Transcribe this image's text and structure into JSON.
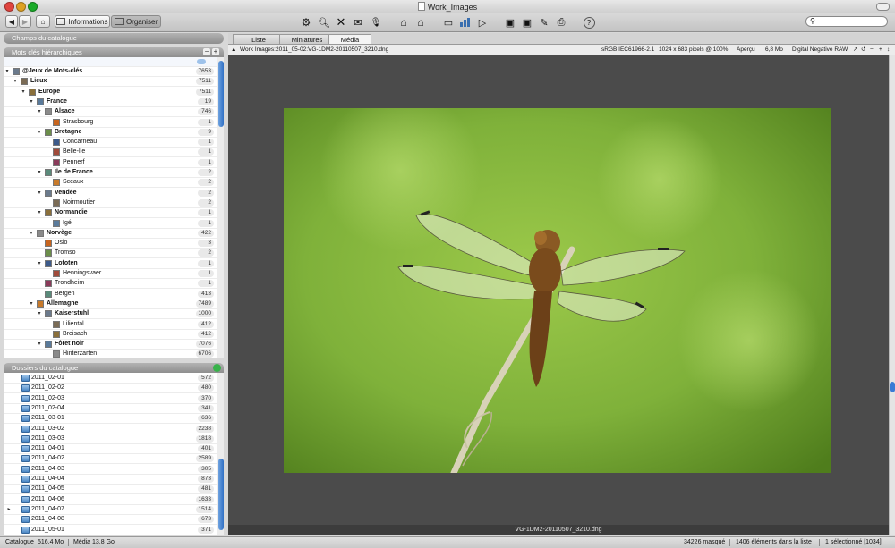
{
  "window": {
    "title": "Work_Images"
  },
  "toolbar": {
    "informations_label": "Informations",
    "organiser_label": "Organiser",
    "search_placeholder": ""
  },
  "catalog_fields_header": "Champs du catalogue",
  "keywords": {
    "header": "Mots clés hiérarchiques",
    "items": [
      {
        "label": "@Jeux de Mots-clés",
        "count": "7653",
        "level": 0,
        "bold": true,
        "expanded": true
      },
      {
        "label": "Lieux",
        "count": "7511",
        "level": 1,
        "bold": true,
        "expanded": true
      },
      {
        "label": "Europe",
        "count": "7511",
        "level": 2,
        "bold": true,
        "expanded": true
      },
      {
        "label": "France",
        "count": "19",
        "level": 3,
        "bold": true,
        "expanded": true
      },
      {
        "label": "Alsace",
        "count": "746",
        "level": 4,
        "bold": true,
        "expanded": true
      },
      {
        "label": "Strasbourg",
        "count": "1",
        "level": 5,
        "bold": false,
        "expanded": false
      },
      {
        "label": "Bretagne",
        "count": "9",
        "level": 4,
        "bold": true,
        "expanded": true
      },
      {
        "label": "Concarneau",
        "count": "1",
        "level": 5,
        "bold": false,
        "expanded": false
      },
      {
        "label": "Belle-Ile",
        "count": "1",
        "level": 5,
        "bold": false,
        "expanded": false
      },
      {
        "label": "Pennerf",
        "count": "1",
        "level": 5,
        "bold": false,
        "expanded": false
      },
      {
        "label": "Ile de France",
        "count": "2",
        "level": 4,
        "bold": true,
        "expanded": true
      },
      {
        "label": "Sceaux",
        "count": "2",
        "level": 5,
        "bold": false,
        "expanded": false
      },
      {
        "label": "Vendée",
        "count": "2",
        "level": 4,
        "bold": true,
        "expanded": true
      },
      {
        "label": "Noirmoutier",
        "count": "2",
        "level": 5,
        "bold": false,
        "expanded": false
      },
      {
        "label": "Normandie",
        "count": "1",
        "level": 4,
        "bold": true,
        "expanded": true
      },
      {
        "label": "Igé",
        "count": "1",
        "level": 5,
        "bold": false,
        "expanded": false
      },
      {
        "label": "Norvège",
        "count": "422",
        "level": 3,
        "bold": true,
        "expanded": true
      },
      {
        "label": "Oslo",
        "count": "3",
        "level": 4,
        "bold": false,
        "expanded": false
      },
      {
        "label": "Tromso",
        "count": "2",
        "level": 4,
        "bold": false,
        "expanded": false
      },
      {
        "label": "Lofoten",
        "count": "1",
        "level": 4,
        "bold": true,
        "expanded": true
      },
      {
        "label": "Henningsvaer",
        "count": "1",
        "level": 5,
        "bold": false,
        "expanded": false
      },
      {
        "label": "Trondheim",
        "count": "1",
        "level": 4,
        "bold": false,
        "expanded": false
      },
      {
        "label": "Bergen",
        "count": "413",
        "level": 4,
        "bold": false,
        "expanded": false
      },
      {
        "label": "Allemagne",
        "count": "7489",
        "level": 3,
        "bold": true,
        "expanded": true
      },
      {
        "label": "Kaiserstuhl",
        "count": "1000",
        "level": 4,
        "bold": true,
        "expanded": true
      },
      {
        "label": "Liliental",
        "count": "412",
        "level": 5,
        "bold": false,
        "expanded": false
      },
      {
        "label": "Breisach",
        "count": "412",
        "level": 5,
        "bold": false,
        "expanded": false
      },
      {
        "label": "Fôret noir",
        "count": "7076",
        "level": 4,
        "bold": true,
        "expanded": true
      },
      {
        "label": "Hinterzarten",
        "count": "6706",
        "level": 5,
        "bold": false,
        "expanded": false
      }
    ]
  },
  "folders": {
    "header": "Dossiers du catalogue",
    "items": [
      {
        "label": "2011_02-01",
        "count": "572"
      },
      {
        "label": "2011_02-02",
        "count": "480"
      },
      {
        "label": "2011_02-03",
        "count": "370"
      },
      {
        "label": "2011_02-04",
        "count": "341"
      },
      {
        "label": "2011_03-01",
        "count": "636"
      },
      {
        "label": "2011_03-02",
        "count": "2238"
      },
      {
        "label": "2011_03-03",
        "count": "1818"
      },
      {
        "label": "2011_04-01",
        "count": "401"
      },
      {
        "label": "2011_04-02",
        "count": "2589"
      },
      {
        "label": "2011_04-03",
        "count": "305"
      },
      {
        "label": "2011_04-04",
        "count": "873"
      },
      {
        "label": "2011_04-05",
        "count": "481"
      },
      {
        "label": "2011_04-06",
        "count": "1633"
      },
      {
        "label": "2011_04-07",
        "count": "1514"
      },
      {
        "label": "2011_04-08",
        "count": "673"
      },
      {
        "label": "2011_05-01",
        "count": "371"
      }
    ]
  },
  "tabs": [
    {
      "label": "Liste",
      "active": false
    },
    {
      "label": "Miniatures",
      "active": false
    },
    {
      "label": "Média",
      "active": true
    }
  ],
  "info": {
    "path": "Work Images:2011_05-02:VG-1DM2-20110507_3210.dng",
    "color_profile": "sRGB IEC61966-2.1",
    "dimensions": "1024 x 683 pixels @ 100%",
    "preview": "Aperçu",
    "size": "6,8 Mo",
    "format": "Digital Negative RAW"
  },
  "caption": "VG-1DM2-20110507_3210.dng",
  "status": {
    "catalog_label": "Catalogue",
    "catalog_size": "516,4 Mo",
    "media_size": "Média 13,8 Go",
    "hidden": "34226 masqué",
    "in_list": "1406 éléments dans la liste",
    "selected": "1 sélectionné [1034]"
  },
  "colors": {
    "accent": "#3a7bd5",
    "viewer_bg": "#4b4b4b"
  }
}
